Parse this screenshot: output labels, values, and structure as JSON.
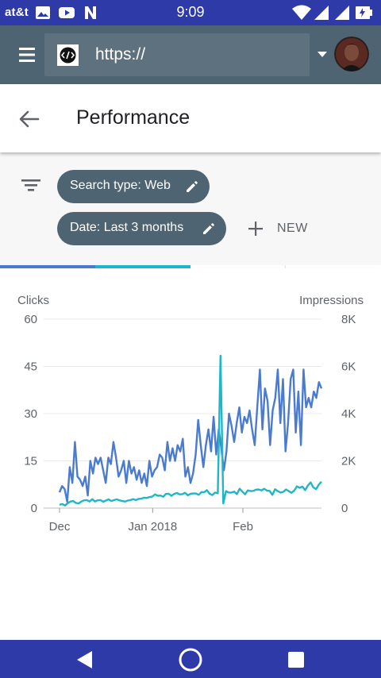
{
  "status_bar": {
    "carrier": "at&t",
    "time": "9:09",
    "left_icons": [
      "image-icon",
      "youtube-icon",
      "n-app-icon"
    ],
    "right_icons": [
      "wifi-icon",
      "signal-icon",
      "signal-icon",
      "battery-icon"
    ]
  },
  "browser": {
    "url": "https://",
    "favicon": "code-icon",
    "menu_icon": "hamburger-menu-icon",
    "account_icon": "dropdown-caret-icon"
  },
  "header": {
    "back_icon": "back-arrow-icon",
    "title": "Performance"
  },
  "filters": {
    "filter_icon": "filter-icon",
    "chips": [
      {
        "label": "Search type: Web",
        "icon": "edit-pencil-icon"
      },
      {
        "label": "Date: Last 3 months",
        "icon": "edit-pencil-icon"
      }
    ],
    "new_label": "NEW",
    "new_icon": "plus-icon"
  },
  "metric_tabs": {
    "colors": [
      "#4a7bd0",
      "#1fb6c6",
      "#ffffff",
      "#ffffff"
    ]
  },
  "chart_data": {
    "type": "line",
    "x_ticks": [
      {
        "label": "Dec",
        "day": 0
      },
      {
        "label": "Jan 2018",
        "day": 32
      },
      {
        "label": "Feb",
        "day": 63
      }
    ],
    "x_range": [
      0,
      90
    ],
    "y_left": {
      "label": "Clicks",
      "ticks": [
        "60",
        "45",
        "30",
        "15",
        "0"
      ],
      "range": [
        0,
        60
      ]
    },
    "y_right": {
      "label": "Impressions",
      "ticks": [
        "8K",
        "6K",
        "4K",
        "2K",
        "0"
      ],
      "range": [
        0,
        8000
      ]
    },
    "grid": true,
    "series": [
      {
        "name": "Clicks",
        "axis": "left",
        "color": "#4a7bd0",
        "values": [
          5,
          7,
          6,
          2,
          13,
          8,
          21,
          10,
          9,
          7,
          10,
          4,
          15,
          11,
          16,
          14,
          16,
          12,
          8,
          16,
          14,
          21,
          16,
          10,
          12,
          15,
          8,
          15,
          11,
          13,
          9,
          12,
          8,
          11,
          7,
          15,
          10,
          12,
          13,
          17,
          16,
          12,
          21,
          15,
          19,
          15,
          20,
          18,
          22,
          10,
          13,
          8,
          11,
          17,
          28,
          20,
          13,
          20,
          25,
          18,
          29,
          17,
          25,
          19,
          12,
          18,
          30,
          26,
          21,
          27,
          32,
          24,
          29,
          27,
          31,
          25,
          20,
          32,
          44,
          25,
          38,
          34,
          20,
          31,
          35,
          44,
          27,
          41,
          18,
          27,
          41,
          44,
          24,
          37,
          20,
          44,
          32,
          35,
          32,
          37,
          35,
          40,
          38
        ]
      },
      {
        "name": "Impressions",
        "axis": "right",
        "color": "#1fb6c6",
        "values": [
          140,
          170,
          110,
          210,
          280,
          300,
          220,
          200,
          280,
          330,
          340,
          280,
          380,
          280,
          330,
          340,
          270,
          320,
          370,
          300,
          340,
          370,
          330,
          300,
          280,
          320,
          340,
          380,
          340,
          390,
          400,
          440,
          430,
          470,
          490,
          580,
          520,
          530,
          480,
          600,
          610,
          520,
          600,
          640,
          580,
          590,
          650,
          540,
          600,
          620,
          620,
          560,
          680,
          670,
          760,
          610,
          550,
          660,
          630,
          6450,
          200,
          720,
          660,
          660,
          700,
          590,
          820,
          700,
          580,
          750,
          720,
          730,
          780,
          790,
          750,
          820,
          740,
          730,
          560,
          800,
          720,
          660,
          690,
          790,
          720,
          650,
          740,
          920,
          860,
          910,
          760,
          950,
          1090,
          880,
          800,
          990,
          1120
        ]
      }
    ]
  },
  "nav_bar": {
    "buttons": [
      "back-triangle-icon",
      "home-circle-icon",
      "recents-square-icon"
    ]
  }
}
